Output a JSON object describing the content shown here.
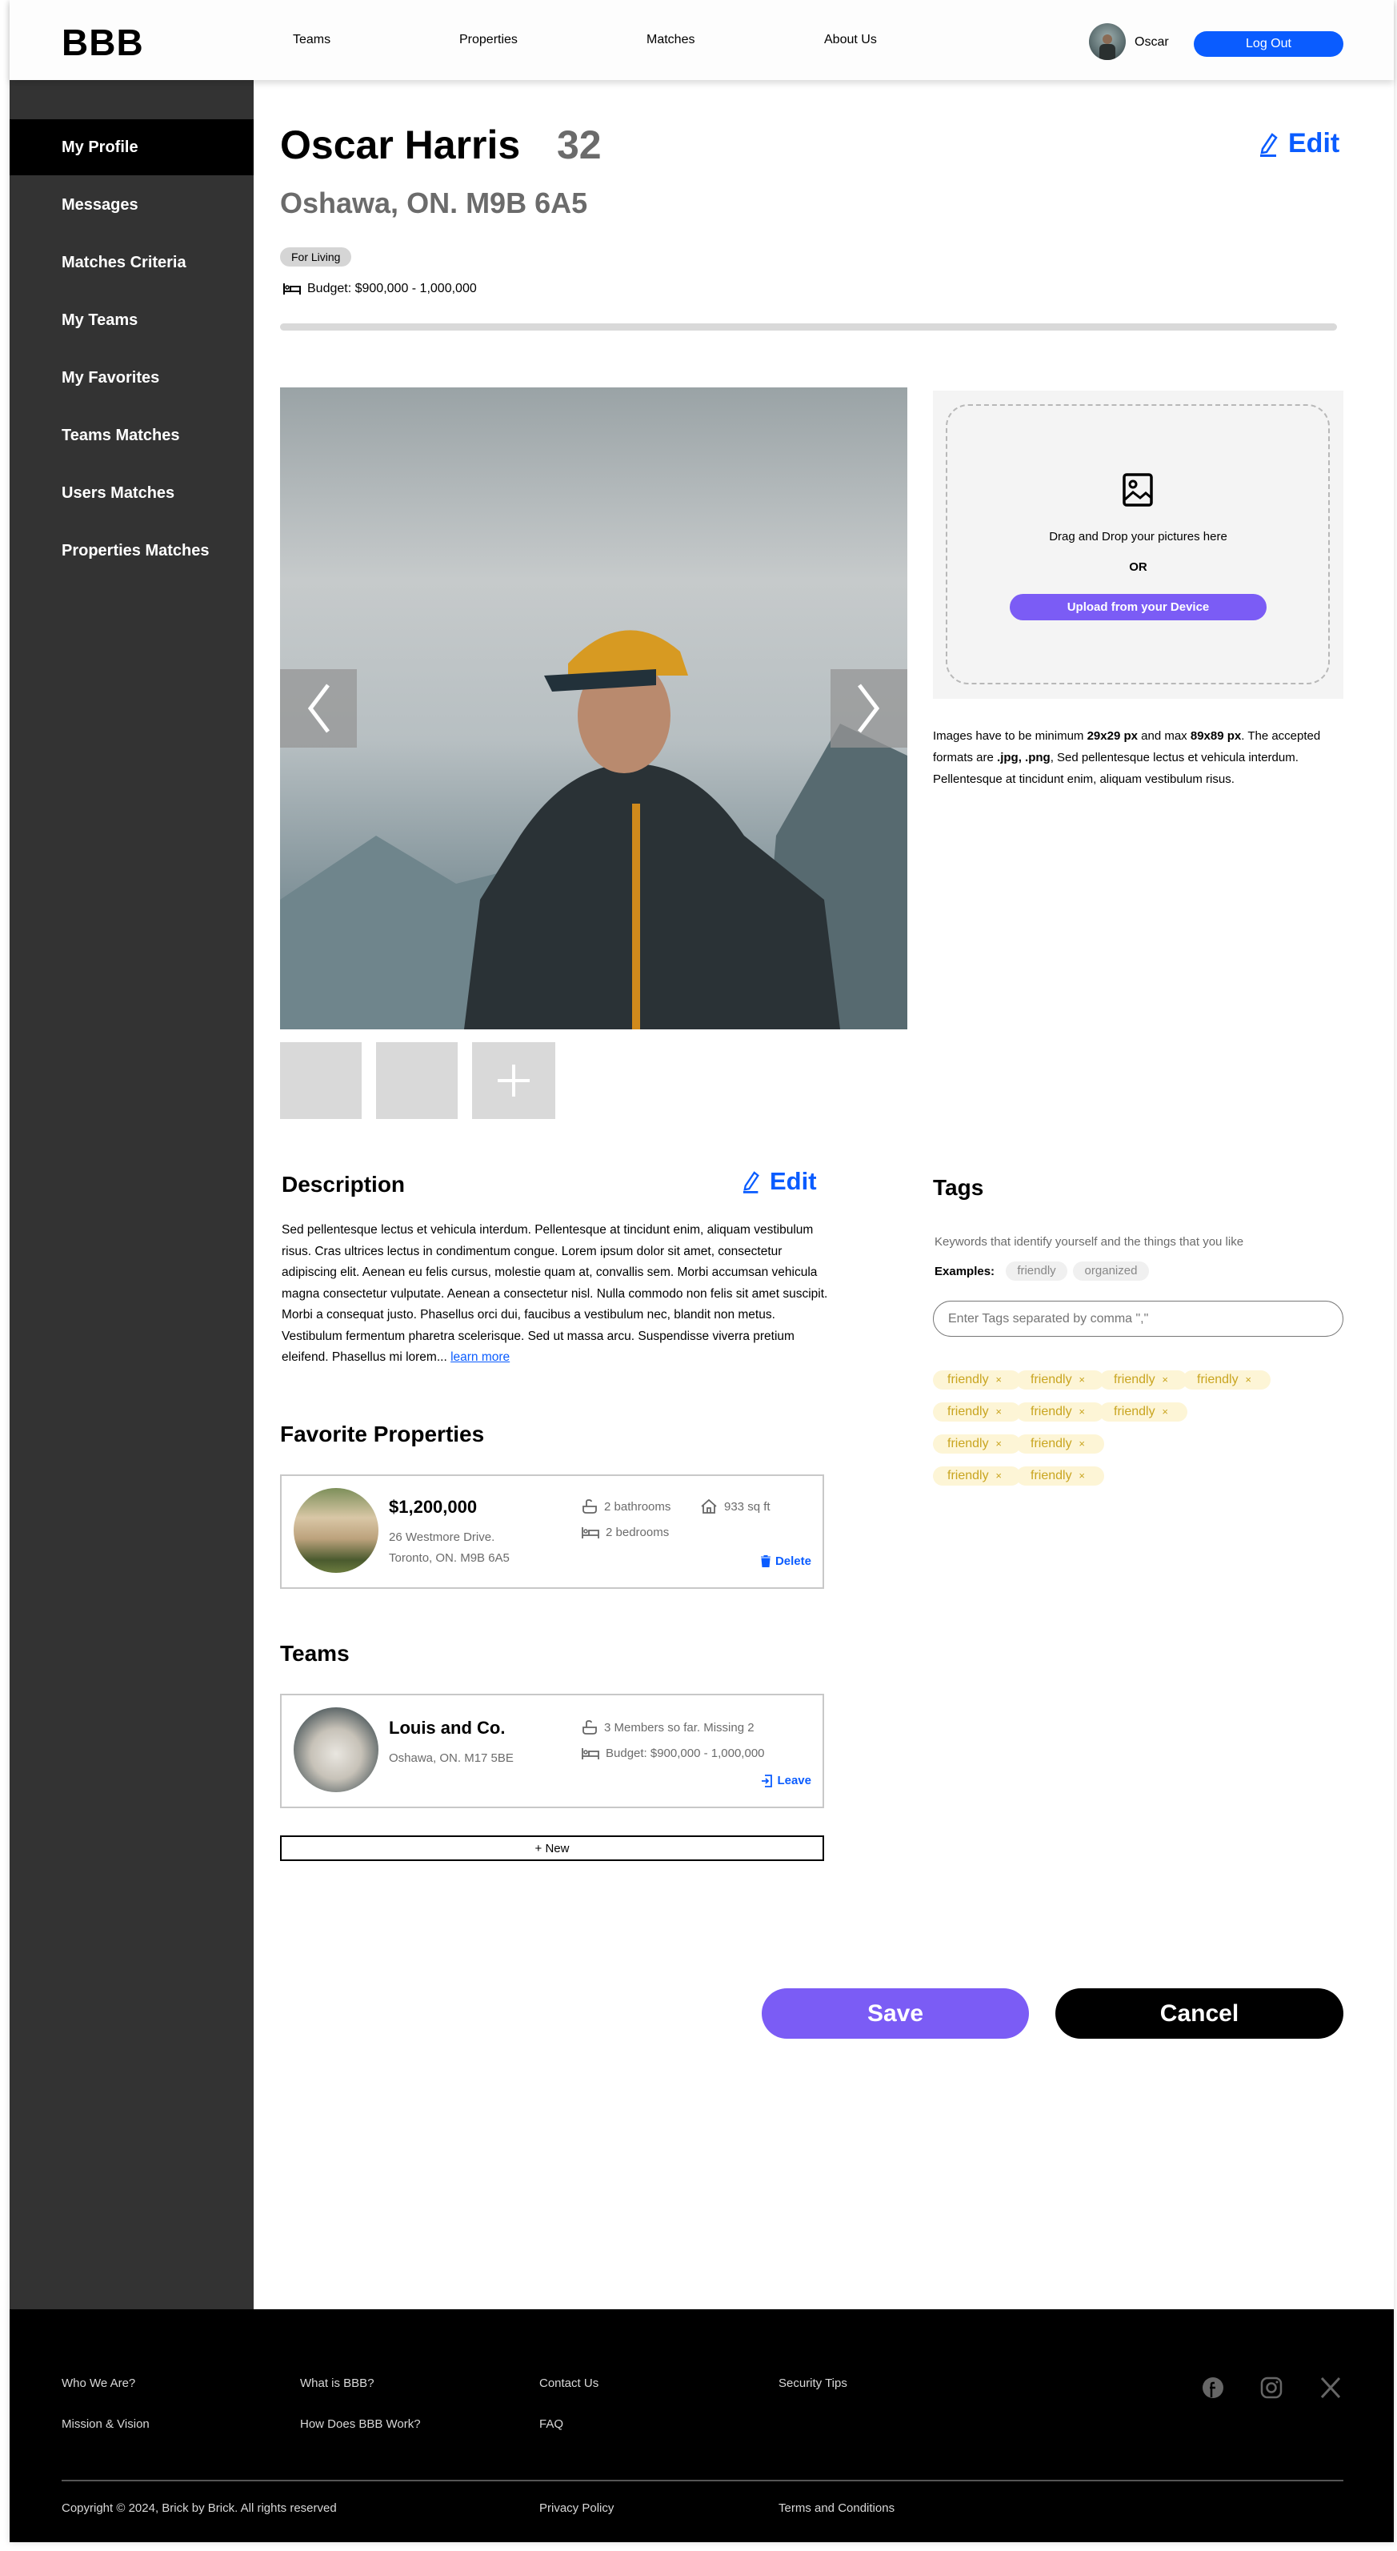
{
  "header": {
    "logo": "BBB",
    "nav": [
      "Teams",
      "Properties",
      "Matches",
      "About Us"
    ],
    "user_name": "Oscar",
    "logout_label": "Log Out"
  },
  "sidebar": {
    "items": [
      "My Profile",
      "Messages",
      "Matches Criteria",
      "My Teams",
      "My Favorites",
      "Teams Matches",
      "Users Matches",
      "Properties Matches"
    ],
    "active": "My Profile"
  },
  "profile": {
    "name": "Oscar Harris",
    "age": "32",
    "location": "Oshawa, ON. M9B 6A5",
    "badge": "For Living",
    "budget": "Budget: $900,000 - 1,000,000",
    "edit_label": "Edit"
  },
  "upload": {
    "drag_text": "Drag and Drop your pictures here",
    "or_text": "OR",
    "button_label": "Upload from your Device",
    "info": {
      "p1": "Images have to be minimum ",
      "min": "29x29 px",
      "p2": " and max ",
      "max": "89x89 px",
      "p3": ". The accepted formats are ",
      "formats": ".jpg, .png",
      "p4": ", Sed pellentesque lectus et vehicula interdum. Pellentesque at tincidunt enim, aliquam vestibulum risus."
    }
  },
  "description": {
    "title": "Description",
    "edit_label": "Edit",
    "text": "Sed pellentesque lectus et vehicula interdum. Pellentesque at tincidunt enim, aliquam vestibulum risus. Cras ultrices lectus in condimentum congue. Lorem ipsum dolor sit amet, consectetur adipiscing elit. Aenean eu felis cursus, molestie quam at, convallis sem. Morbi accumsan vehicula magna consectetur vulputate. Aenean a consectetur nisl. Nulla commodo non felis sit amet suscipit. Morbi a consequat justo. Phasellus orci dui, faucibus a vestibulum nec, blandit non metus. Vestibulum fermentum pharetra scelerisque. Sed ut massa arcu. Suspendisse viverra pretium eleifend. Phasellus mi lorem... ",
    "learn_more": "learn more"
  },
  "favorites": {
    "title": "Favorite Properties",
    "property": {
      "price": "$1,200,000",
      "address1": "26 Westmore Drive.",
      "address2": "Toronto, ON. M9B 6A5",
      "bathrooms": "2 bathrooms",
      "area": "933 sq ft",
      "bedrooms": "2 bedrooms",
      "delete_label": "Delete"
    }
  },
  "teams": {
    "title": "Teams",
    "team": {
      "name": "Louis and Co.",
      "location": "Oshawa, ON. M17 5BE",
      "members": "3 Members so far. Missing 2",
      "budget": "Budget: $900,000 - 1,000,000",
      "leave_label": "Leave"
    },
    "new_label": "+ New"
  },
  "tags": {
    "title": "Tags",
    "subtitle": "Keywords that identify yourself and the things that you like",
    "examples_label": "Examples:",
    "examples": [
      "friendly",
      "organized"
    ],
    "input_placeholder": "Enter Tags separated by comma \",\"",
    "items": [
      "friendly",
      "friendly",
      "friendly",
      "friendly",
      "friendly",
      "friendly",
      "friendly",
      "friendly",
      "friendly",
      "friendly",
      "friendly"
    ],
    "remove_glyph": "×"
  },
  "actions": {
    "save_label": "Save",
    "cancel_label": "Cancel"
  },
  "footer": {
    "links": [
      "Who We Are?",
      "What is BBB?",
      "Contact Us",
      "Security Tips",
      "Mission & Vision",
      "How Does BBB Work?",
      "FAQ"
    ],
    "copyright": "Copyright © 2024, Brick by Brick. All rights reserved",
    "privacy": "Privacy Policy",
    "terms": "Terms and Conditions"
  },
  "colors": {
    "accent_blue": "#0a5cff",
    "purple": "#7b5cf5",
    "sidebar": "#333333",
    "tag_bg": "#fdf5d6",
    "tag_text": "#c9a520"
  }
}
